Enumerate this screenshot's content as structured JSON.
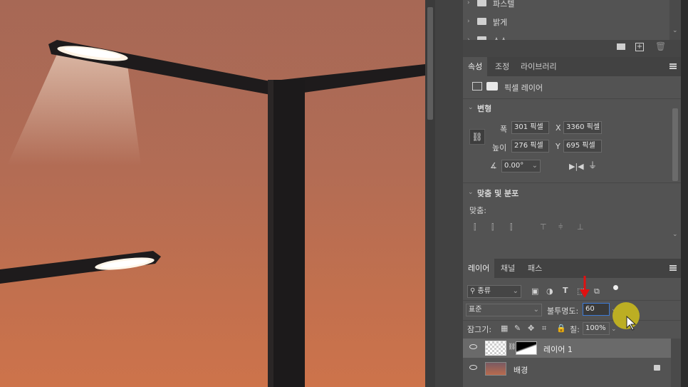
{
  "folders": {
    "items": [
      {
        "label": "파스텔"
      },
      {
        "label": "밝게"
      },
      {
        "label": "소스"
      }
    ]
  },
  "properties": {
    "tabs": [
      "속성",
      "조정",
      "라이브러리"
    ],
    "layer_type": "픽셀 레이어",
    "transform_title": "변형",
    "width_label": "폭",
    "width_value": "301 픽셀",
    "height_label": "높이",
    "height_value": "276 픽셀",
    "x_label": "X",
    "x_value": "3360 픽셀",
    "y_label": "Y",
    "y_value": "695 픽셀",
    "angle_value": "0.00°",
    "align_title": "맞춤 및 분포",
    "align_label": "맞춤:"
  },
  "layers": {
    "tabs": [
      "레이어",
      "채널",
      "패스"
    ],
    "filter_label": "종류",
    "blend_mode": "표준",
    "opacity_label": "불투명도:",
    "opacity_value": "60",
    "lock_label": "잠그기:",
    "fill_label": "칠:",
    "fill_value": "100%",
    "items": [
      {
        "name": "레이어 1"
      },
      {
        "name": "배경"
      }
    ]
  },
  "colors": {
    "accent_highlight": "#c8b81e",
    "annotation_arrow": "#e01010"
  }
}
